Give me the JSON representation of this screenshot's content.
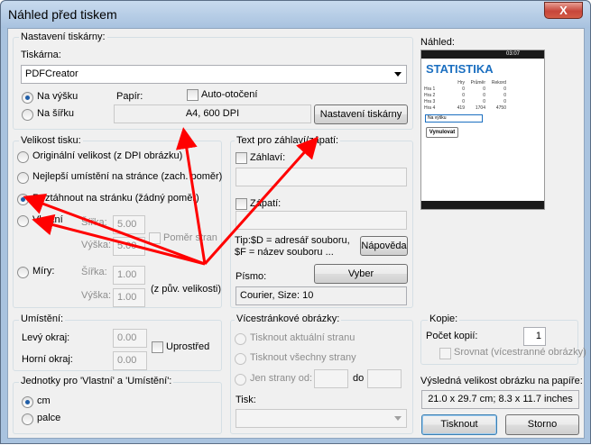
{
  "window": {
    "title": "Náhled před tiskem",
    "close_label": "X"
  },
  "printer_settings": {
    "group_label": "Nastavení tiskárny:",
    "printer_label": "Tiskárna:",
    "printer_value": "PDFCreator",
    "portrait_label": "Na výšku",
    "landscape_label": "Na šířku",
    "paper_label": "Papír:",
    "auto_rotate_label": "Auto-otočení",
    "paper_value": "A4,       600 DPI",
    "printer_settings_button": "Nastavení tiskárny"
  },
  "print_size": {
    "group_label": "Velikost tisku:",
    "original_label": "Originální velikost (z DPI obrázku)",
    "best_fit_label": "Nejlepší umístění na stránce (zach. poměr)",
    "stretch_label": "Roztáhnout na stránku (žádný poměr)",
    "custom_label": "Vlastní",
    "custom_width_label": "Šířka:",
    "custom_width_value": "5.00",
    "custom_height_label": "Výška:",
    "custom_height_value": "5.00",
    "keep_ratio_label": "Poměr stran",
    "scale_label": "Míry:",
    "scale_width_label": "Šířka:",
    "scale_width_value": "1.00",
    "scale_height_label": "Výška:",
    "scale_height_value": "1.00",
    "scale_note": "(z pův. velikosti)"
  },
  "header_footer": {
    "group_label": "Text pro záhlaví/zápatí:",
    "header_label": "Záhlaví:",
    "footer_label": "Zápatí:",
    "tip_line1": "Tip:$D = adresář souboru,",
    "tip_line2": "$F = název souboru ...",
    "help_button": "Nápověda",
    "font_label": "Písmo:",
    "font_button": "Vyber",
    "font_value": "Courier, Size: 10"
  },
  "preview": {
    "label": "Náhled:",
    "status_time": "03:07",
    "app_title": "STATISTIKA",
    "columns": [
      "",
      "Hry",
      "Průměr",
      "Rekord"
    ],
    "rows": [
      [
        "Hra 1",
        "0",
        "0",
        "0"
      ],
      [
        "Hra 2",
        "0",
        "0",
        "0"
      ],
      [
        "Hra 3",
        "0",
        "0",
        "0"
      ],
      [
        "Hra 4",
        "419",
        "1704",
        "4750"
      ]
    ],
    "dropdown_value": "Na výšku",
    "button_label": "Vynulovat"
  },
  "placement": {
    "group_label": "Umístění:",
    "left_margin_label": "Levý okraj:",
    "left_margin_value": "0.00",
    "top_margin_label": "Horní okraj:",
    "top_margin_value": "0.00",
    "center_label": "Uprostřed"
  },
  "units": {
    "group_label": "Jednotky pro 'Vlastní' a 'Umístění':",
    "cm_label": "cm",
    "inch_label": "palce"
  },
  "multipage": {
    "group_label": "Vícestránkové obrázky:",
    "current_label": "Tisknout aktuální stranu",
    "all_label": "Tisknout všechny strany",
    "range_label": "Jen strany od:",
    "range_to_label": "do",
    "print_label": "Tisk:"
  },
  "copies": {
    "group_label": "Kopie:",
    "count_label": "Počet kopií:",
    "count_value": "1",
    "collate_label": "Srovnat (vícestranné obrázky)"
  },
  "result": {
    "label": "Výsledná velikost obrázku na papíře:",
    "value": "21.0 x 29.7 cm; 8.3 x 11.7 inches"
  },
  "actions": {
    "print_button": "Tisknout",
    "cancel_button": "Storno"
  },
  "annotation_color": "#ff0000"
}
